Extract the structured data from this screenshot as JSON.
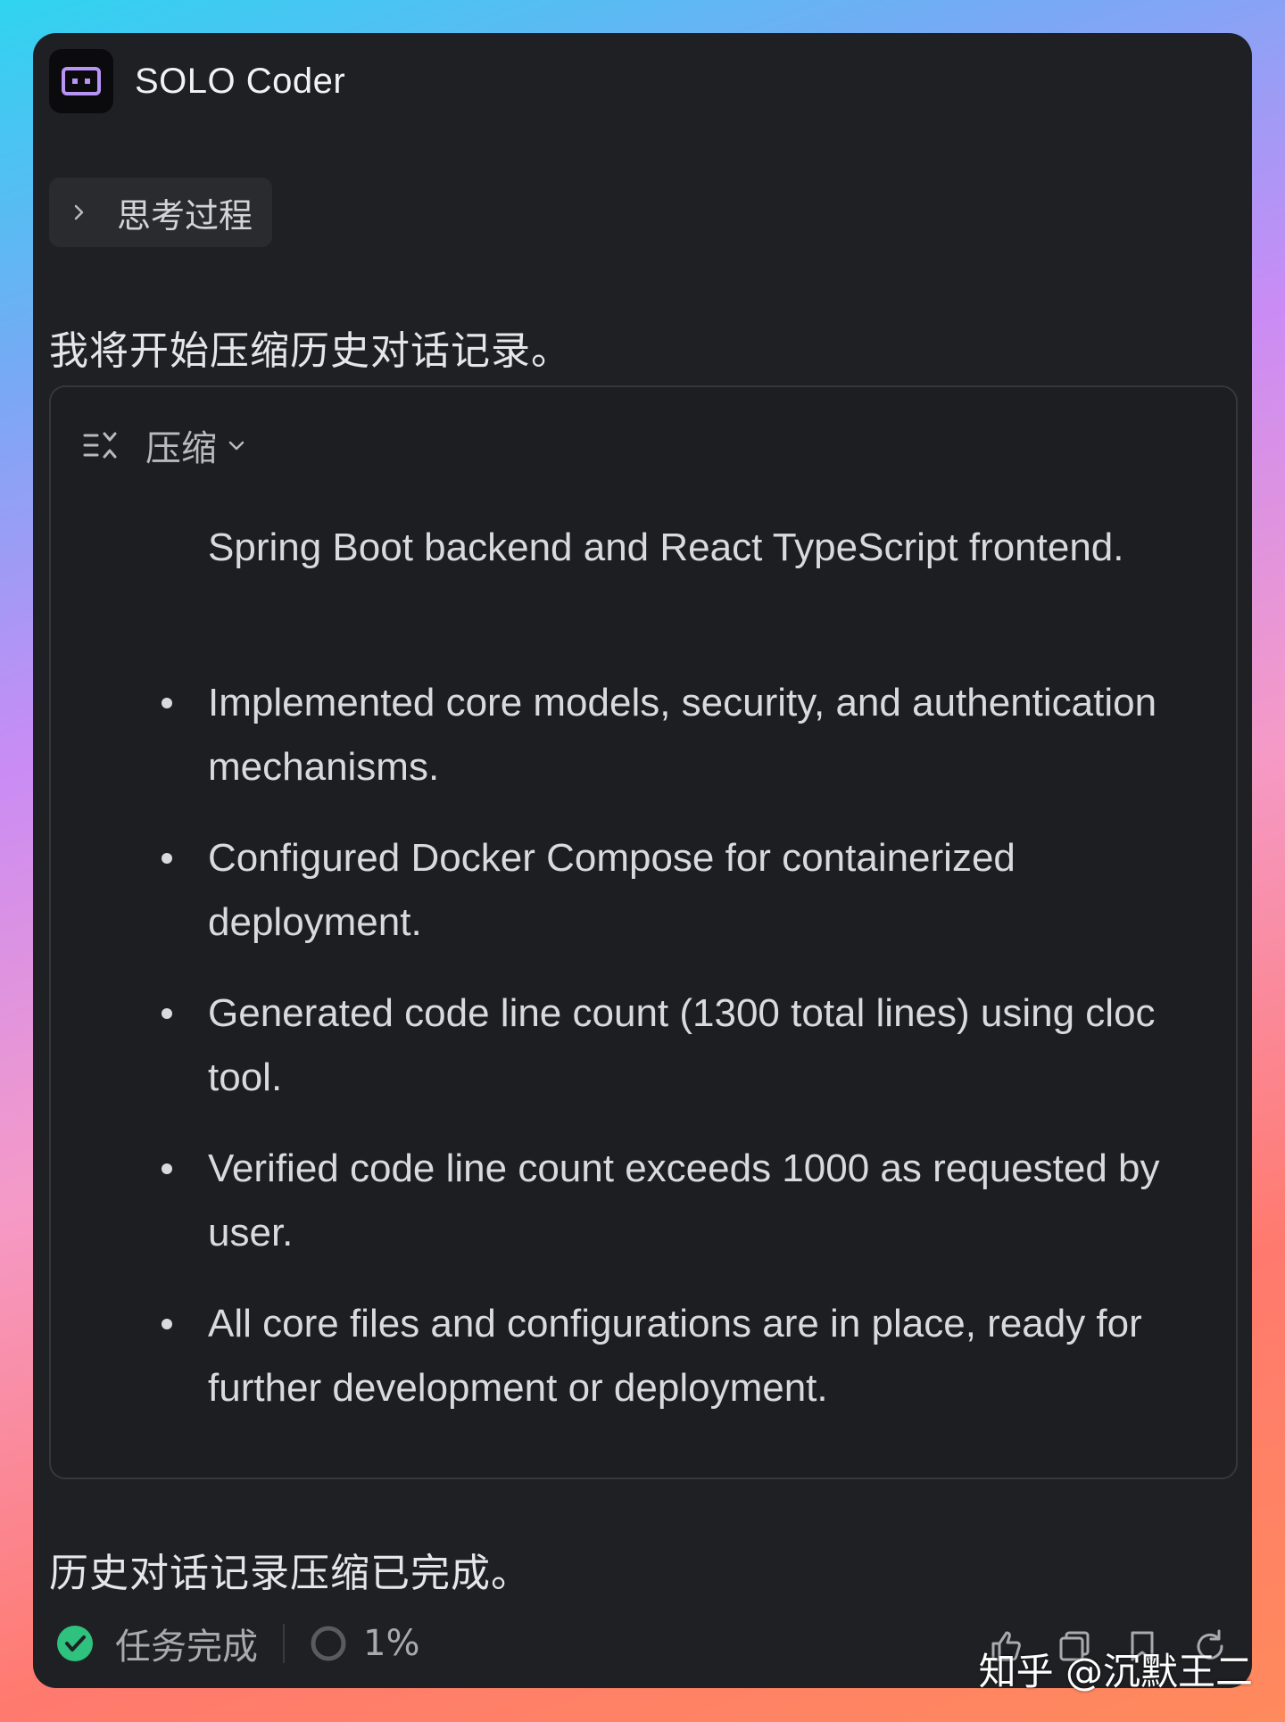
{
  "app": {
    "title": "SOLO Coder",
    "icon": "robot-face-icon"
  },
  "thinking": {
    "label": "思考过程"
  },
  "messages": {
    "intro": "我将开始压缩历史对话记录。",
    "done": "历史对话记录压缩已完成。"
  },
  "compress": {
    "label": "压缩",
    "first_item_text": "Spring Boot backend and React TypeScript frontend.",
    "items": [
      "Implemented core models, security, and authentication mechanisms.",
      "Configured Docker Compose for containerized deployment.",
      "Generated code line count (1300 total lines) using cloc tool.",
      "Verified code line count exceeds 1000 as requested by user.",
      "All core files and configurations are in place, ready for further development or deployment."
    ]
  },
  "footer": {
    "status": "任务完成",
    "progress": "1%"
  },
  "watermark": "知乎 @沉默王二",
  "colors": {
    "card_bg": "#1f2023",
    "status_green": "#2ec27e",
    "accent_purple": "#b794f6"
  }
}
